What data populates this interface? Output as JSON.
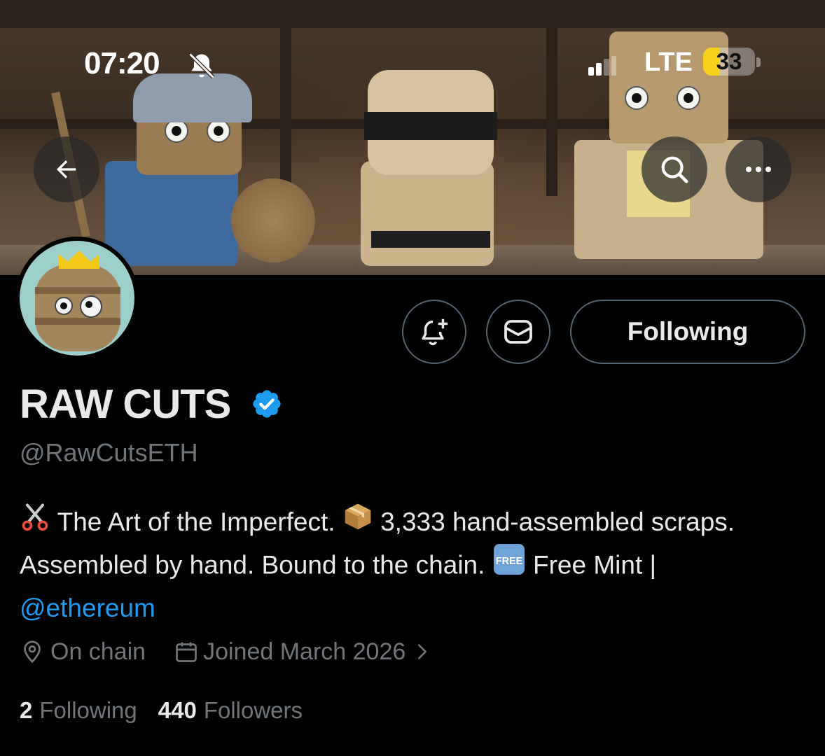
{
  "status_bar": {
    "time": "07:20",
    "network": "LTE",
    "battery": "33",
    "battery_level": 0.33
  },
  "header": {
    "back_icon": "arrow-left-icon",
    "search_icon": "search-icon",
    "more_icon": "more-horizontal-icon"
  },
  "actions": {
    "notify_icon": "bell-plus-icon",
    "message_icon": "envelope-icon",
    "follow_label": "Following"
  },
  "profile": {
    "name": "RAW CUTS",
    "verified_icon": "verified-badge-icon",
    "verified_color": "#1d9bf0",
    "handle": "@RawCutsETH",
    "bio": {
      "emoji_1": "scissors-icon",
      "part_1": "The Art of the Imperfect.",
      "emoji_2": "package-icon",
      "part_2": "3,333 hand-assembled scraps. Assembled by hand. Bound to the chain.",
      "emoji_3": "free-button-icon",
      "emoji_3_text": "FREE",
      "part_3": "Free Mint |",
      "mention": "@ethereum",
      "mention_color": "#1d9bf0"
    },
    "location": "On chain",
    "joined": "Joined March 2026",
    "following_count": "2",
    "following_label": "Following",
    "followers_count": "440",
    "followers_label": "Followers"
  }
}
